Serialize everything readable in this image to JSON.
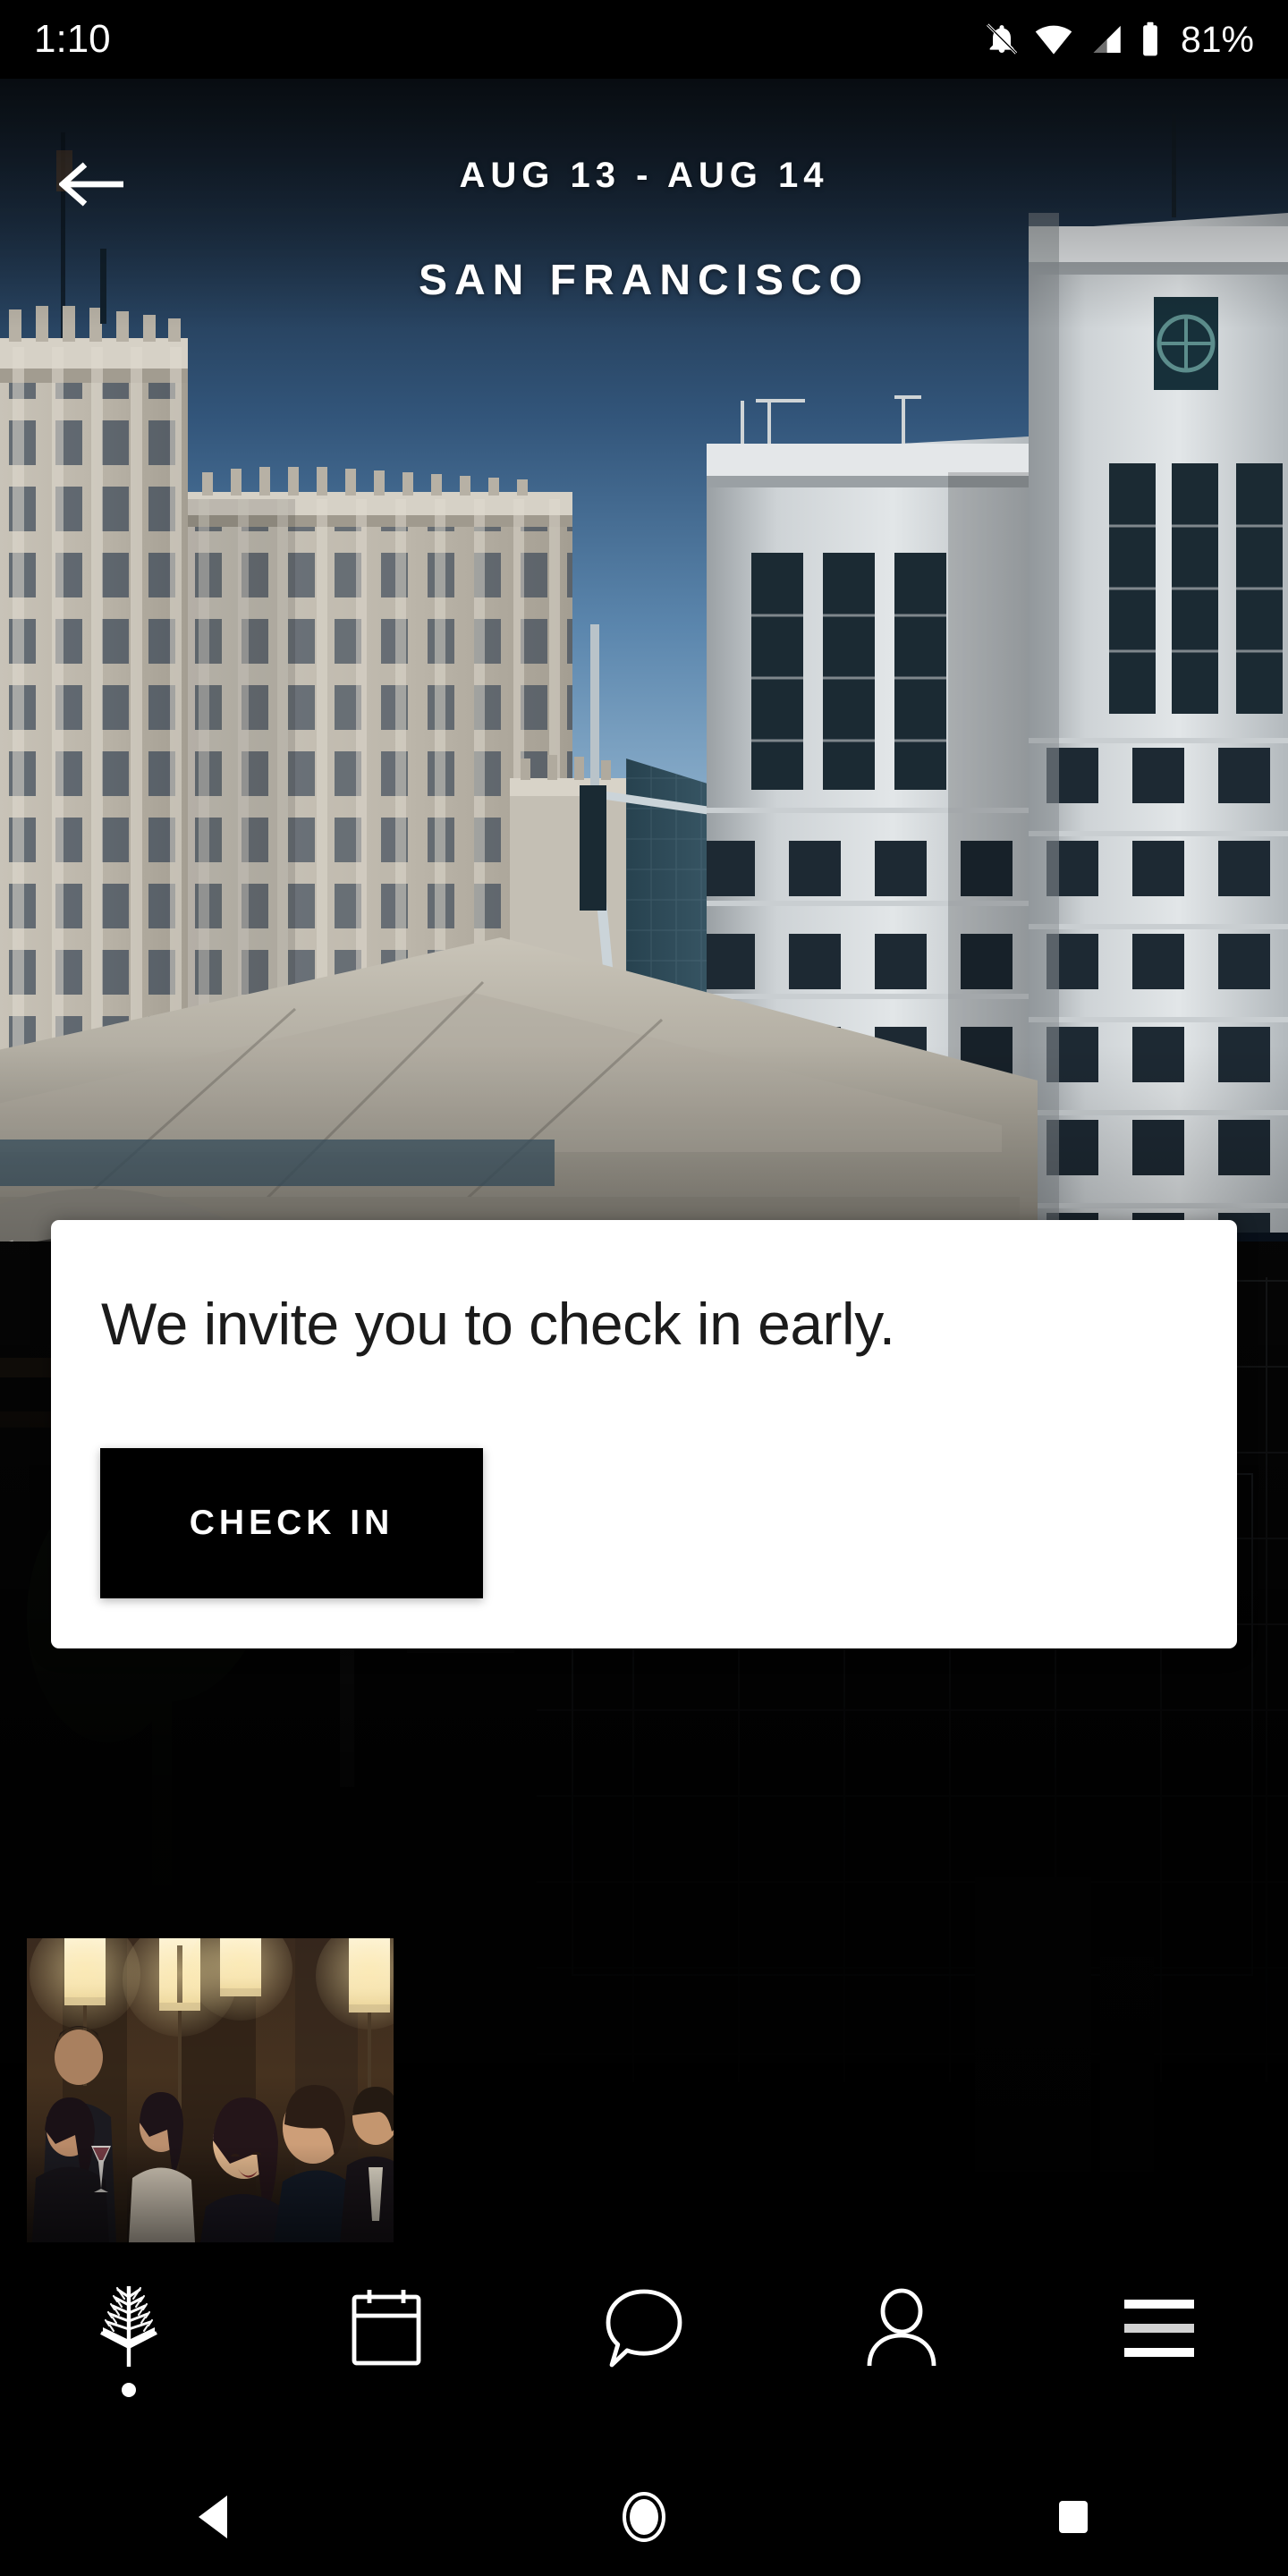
{
  "status_bar": {
    "time": "1:10",
    "battery_percent": "81%",
    "icons": [
      "notifications-off-icon",
      "wifi-icon",
      "cellular-signal-icon",
      "battery-icon"
    ]
  },
  "header": {
    "back_icon": "back-arrow-icon",
    "dates": "AUG 13 - AUG 14",
    "city": "SAN FRANCISCO"
  },
  "hero": {
    "alt": "San Francisco skyline with Art Deco and modern towers at dusk",
    "sky_color": "#2d4f70",
    "building_light": "#d7d4cc",
    "building_dark": "#0b0b0c"
  },
  "card": {
    "title": "We invite you to check in early.",
    "button_label": "CHECK IN",
    "button_bg": "#000000",
    "card_bg": "#ffffff"
  },
  "promo": {
    "alt": "Guests socializing at hotel bar with warm pendant lights"
  },
  "bottom_nav": {
    "items": [
      {
        "icon": "tree-logo-icon",
        "active": true
      },
      {
        "icon": "calendar-icon",
        "active": false
      },
      {
        "icon": "chat-bubble-icon",
        "active": false
      },
      {
        "icon": "person-icon",
        "active": false
      },
      {
        "icon": "hamburger-menu-icon",
        "active": false
      }
    ],
    "accent": "#ffffff"
  },
  "system_nav": {
    "back_icon": "android-back-triangle-icon",
    "home_icon": "android-home-circle-icon",
    "recents_icon": "android-recents-square-icon"
  }
}
